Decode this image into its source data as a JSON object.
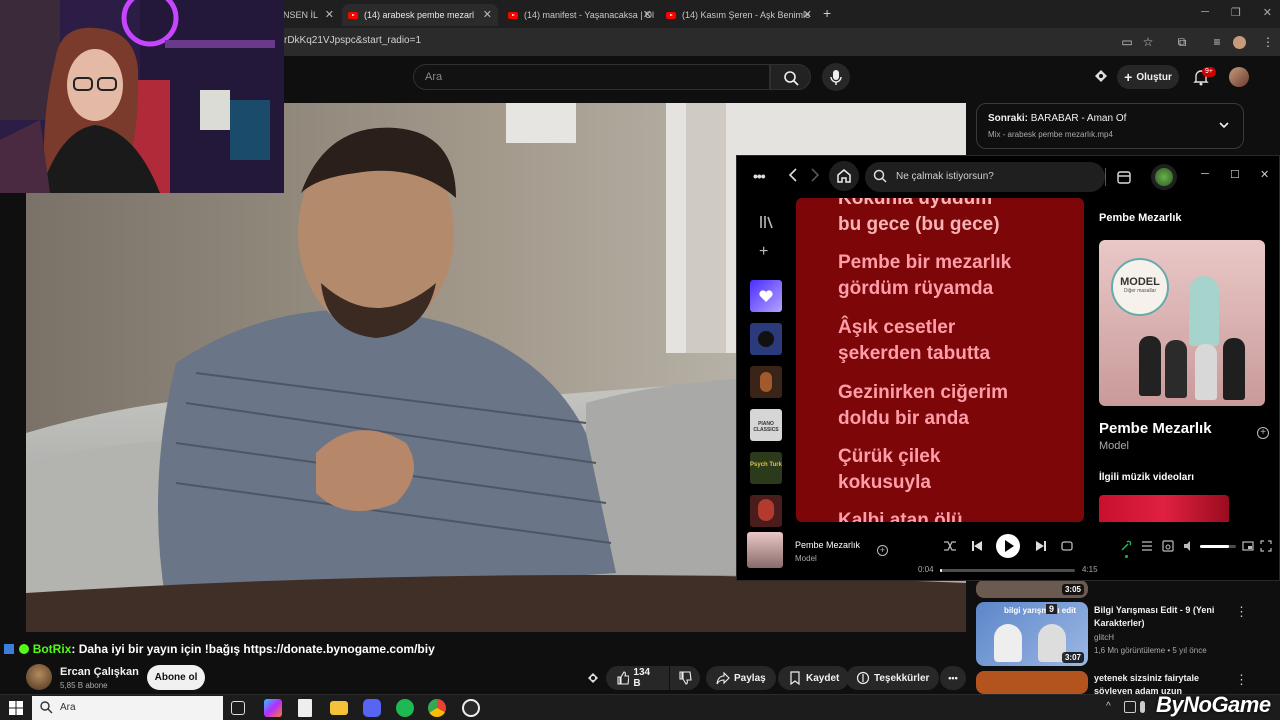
{
  "browser": {
    "tabs": [
      {
        "title": "ÖNSEN İL"
      },
      {
        "title": "(14) arabesk pembe mezarl"
      },
      {
        "title": "(14) manifest - Yaşanacaksa | Ol"
      },
      {
        "title": "(14) Kasım Şeren - Aşk Benimle"
      }
    ],
    "new_tab": "+",
    "url": "rDkKq21VJpspc&start_radio=1"
  },
  "youtube": {
    "search_placeholder": "Ara",
    "create_label": "Oluştur",
    "notification_badge": "9+",
    "next_label": "Sonraki:",
    "next_title": "BARABAR - Aman Of",
    "next_sub": "Mix - arabesk pembe mezarlık.mp4",
    "channel_name": "Ercan Çalışkan",
    "channel_subs": "5,85 B abone",
    "subscribe_label": "Abone ol",
    "likes": "134 B",
    "share_label": "Paylaş",
    "save_label": "Kaydet",
    "thanks_label": "Teşekkürler",
    "more": "•••",
    "recs": [
      {
        "duration": "3:05"
      },
      {
        "duration": "3:07",
        "title": "Bilgi Yarışması Edit - 9 (Yeni Karakterler)",
        "channel": "glitcH",
        "meta": "1,6 Mn görüntüleme • 5 yıl önce",
        "thumb_text": "bilgi yarışması edit",
        "thumb_num": "9"
      },
      {
        "title": "yetenek sizsiniz fairytale söyleyen adam uzun"
      }
    ]
  },
  "chat": {
    "user": "BotRix",
    "message": ": Daha iyi bir yayın için !bağış https://donate.bynogame.com/biy"
  },
  "spotify": {
    "search_placeholder": "Ne çalmak istiyorsun?",
    "lyrics": [
      "Kokunla uyudum",
      "bu gece (bu gece)",
      "Pembe bir mezarlık",
      "gördüm rüyamda",
      "Âşık cesetler",
      "şekerden tabutta",
      "Gezinirken ciğerim",
      "doldu bir anda",
      "Çürük çilek",
      "kokusuyla",
      "Kalbi atan ölü"
    ],
    "panel_title": "Pembe Mezarlık",
    "album_logo": "MODEL",
    "album_logo_sub": "Diğer masallar",
    "track_title": "Pembe Mezarlık",
    "artist": "Model",
    "related_videos": "İlgili müzik videoları",
    "now_playing_title": "Pembe Mezarlık",
    "now_playing_artist": "Model",
    "time_current": "0:04",
    "time_total": "4:15",
    "progress": 0.016,
    "volume": 0.8,
    "lib_covers": [
      {
        "label": "",
        "color": "#7a5cff",
        "icon": "heart-icon"
      },
      {
        "label": "",
        "color": "#2a3a7a"
      },
      {
        "label": "",
        "color": "#3a2418"
      },
      {
        "label": "PIANO CLASSICS",
        "color": "#d6d6d6"
      },
      {
        "label": "Psych Turk",
        "color": "#2c3a1c"
      },
      {
        "label": "",
        "color": "#4a1c1c"
      }
    ]
  },
  "taskbar": {
    "search_placeholder": "Ara"
  },
  "watermark": "ByNoGame",
  "colors": {
    "youtube_red": "#ff0000",
    "spotify_green": "#1db954",
    "lyrics_bg": "#7c0608"
  }
}
